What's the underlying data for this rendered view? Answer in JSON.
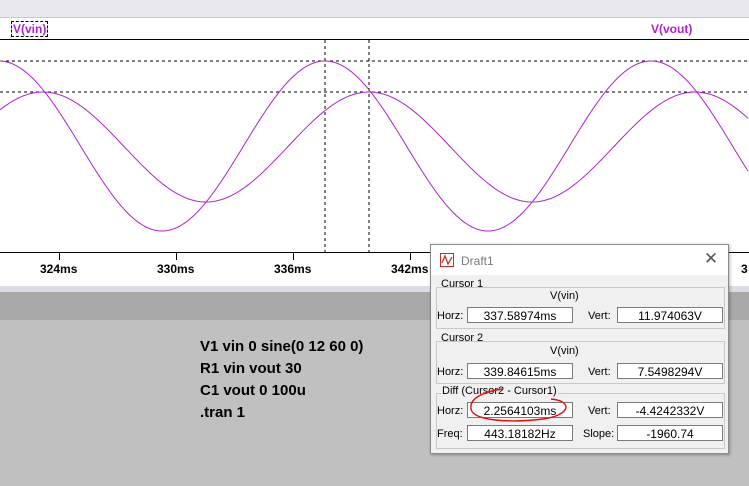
{
  "plot": {
    "traces": [
      {
        "name": "V(vin)",
        "color": "#b020d0"
      },
      {
        "name": "V(vout)",
        "color": "#b020d0"
      }
    ],
    "x_ticks": [
      "324ms",
      "330ms",
      "336ms",
      "342ms",
      "3"
    ]
  },
  "netlist": {
    "lines": [
      "V1 vin 0 sine(0 12 60 0)",
      "R1 vin vout 30",
      "C1 vout 0 100u",
      ".tran 1"
    ]
  },
  "dialog": {
    "title": "Draft1",
    "cursor1": {
      "group": "Cursor 1",
      "signal": "V(vin)",
      "horz_label": "Horz:",
      "horz": "337.58974ms",
      "vert_label": "Vert:",
      "vert": "11.974063V"
    },
    "cursor2": {
      "group": "Cursor 2",
      "signal": "V(vin)",
      "horz_label": "Horz:",
      "horz": "339.84615ms",
      "vert_label": "Vert:",
      "vert": "7.5498294V"
    },
    "diff": {
      "group": "Diff (Cursor2 - Cursor1)",
      "horz_label": "Horz:",
      "horz": "2.2564103ms",
      "vert_label": "Vert:",
      "vert": "-4.4242332V",
      "freq_label": "Freq:",
      "freq": "443.18182Hz",
      "slope_label": "Slope:",
      "slope": "-1960.74"
    }
  },
  "colors": {
    "trace": "#b020d0",
    "annotation": "#dd1010"
  }
}
